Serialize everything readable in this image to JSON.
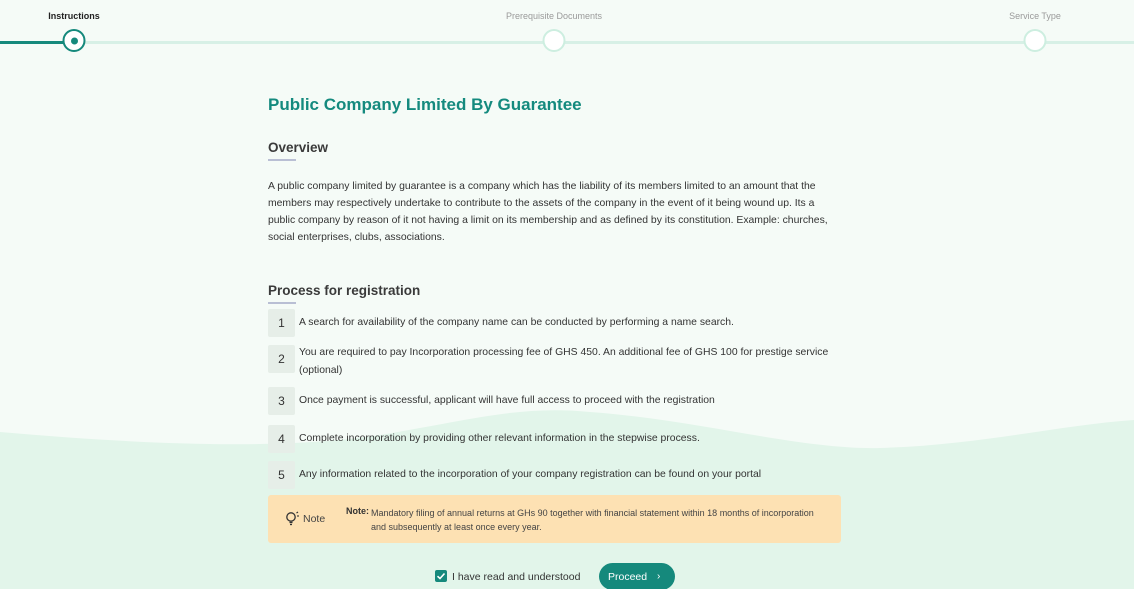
{
  "stepper": {
    "steps": [
      {
        "label": "Instructions",
        "state": "active"
      },
      {
        "label": "Prerequisite Documents",
        "state": "pending"
      },
      {
        "label": "Service Type",
        "state": "pending"
      }
    ]
  },
  "page": {
    "title": "Public Company Limited By Guarantee"
  },
  "overview": {
    "heading": "Overview",
    "text": "A public company limited by guarantee is a company which has the liability of its members limited to an amount that the members may respectively undertake to contribute to the assets of the company in the event of it being wound up. Its a public company by reason of it not having a limit on its membership and as defined by its constitution. Example: churches, social enterprises, clubs, associations."
  },
  "process": {
    "heading": "Process for registration",
    "items": [
      {
        "number": "1",
        "text": "A search for availability of the company name can be conducted by performing a name search."
      },
      {
        "number": "2",
        "text": "You are required to pay Incorporation processing fee of GHS 450. An additional fee of GHS 100 for prestige service (optional)"
      },
      {
        "number": "3",
        "text": "Once payment is successful, applicant will have full access to proceed with the registration"
      },
      {
        "number": "4",
        "text": "Complete incorporation by providing other relevant information in the stepwise process."
      },
      {
        "number": "5",
        "text": "Any information related to the incorporation of your company registration can be found on your portal"
      }
    ]
  },
  "note": {
    "icon": "lightbulb-icon",
    "label": "Note",
    "title": "Note:",
    "text": "Mandatory filing of annual returns at GHs 90 together with financial statement within 18 months of incorporation and subsequently at least once every year."
  },
  "agreement": {
    "label": "I have read and understood",
    "checked": true
  },
  "actions": {
    "proceed_label": "Proceed",
    "proceed_icon": "chevron-right-icon"
  },
  "colors": {
    "primary": "#15897c",
    "note_bg": "#fde1b3",
    "wave": "#e2f5ea"
  }
}
